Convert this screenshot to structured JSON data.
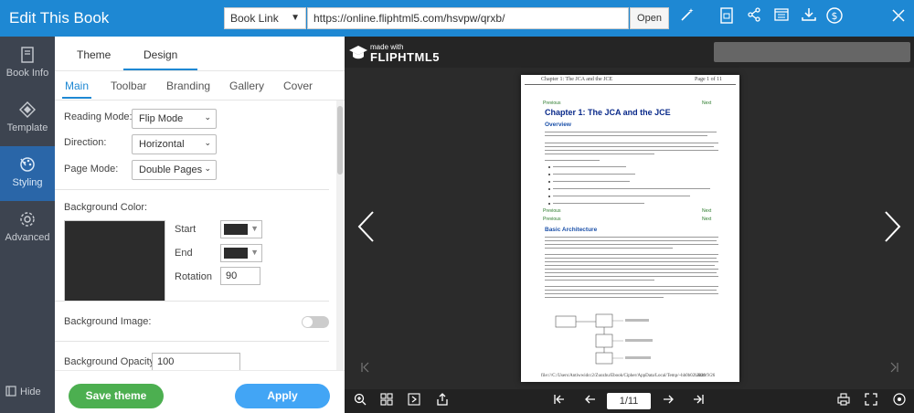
{
  "app": {
    "title": "Edit This Book",
    "link_type": "Book Link",
    "url": "https://online.fliphtml5.com/hsvpw/qrxb/",
    "open_label": "Open"
  },
  "toolbar_icons": [
    "magic-wand-icon",
    "pdf-icon",
    "share-icon",
    "embed-icon",
    "download-icon",
    "dollar-icon",
    "close-icon"
  ],
  "leftnav": {
    "items": [
      {
        "label": "Book Info",
        "icon": "book-icon"
      },
      {
        "label": "Template",
        "icon": "template-icon"
      },
      {
        "label": "Styling",
        "icon": "palette-icon"
      },
      {
        "label": "Advanced",
        "icon": "gear-icon"
      }
    ],
    "active": "Styling",
    "hide_label": "Hide"
  },
  "panel": {
    "tabs": [
      "Theme",
      "Design"
    ],
    "active_tab": "Design",
    "subtabs": [
      "Main",
      "Toolbar",
      "Branding",
      "Gallery",
      "Cover"
    ],
    "active_subtab": "Main",
    "reading_mode": {
      "label": "Reading Mode:",
      "value": "Flip Mode"
    },
    "direction": {
      "label": "Direction:",
      "value": "Horizontal"
    },
    "page_mode": {
      "label": "Page Mode:",
      "value": "Double Pages"
    },
    "background_color": {
      "label": "Background Color:",
      "start_label": "Start",
      "end_label": "End",
      "rotation_label": "Rotation",
      "rotation_value": "90",
      "start_color": "#2c2c2c",
      "end_color": "#2c2c2c"
    },
    "background_image": {
      "label": "Background Image:",
      "enabled": false
    },
    "background_opacity": {
      "label": "Background Opacity:",
      "value": "100"
    },
    "save_label": "Save theme",
    "apply_label": "Apply"
  },
  "preview": {
    "logo_small": "made with",
    "logo_main": "FLIPHTML5",
    "page_indicator": "1/11",
    "doc": {
      "header_left": "Chapter 1: The JCA and the JCE",
      "header_right": "Page 1 of 11",
      "prev_label": "Previous",
      "next_label": "Next",
      "title": "Chapter 1: The JCA and the JCE",
      "overview_heading": "Overview",
      "basic_heading": "Basic Architecture",
      "footer_left": "file:///C:/Users/Antiwwidcc2/Zuozhu/Ebook/Cipher/AppData/Local/Temp/~hh0b02b.htm",
      "footer_right": "2020/9/26"
    }
  }
}
